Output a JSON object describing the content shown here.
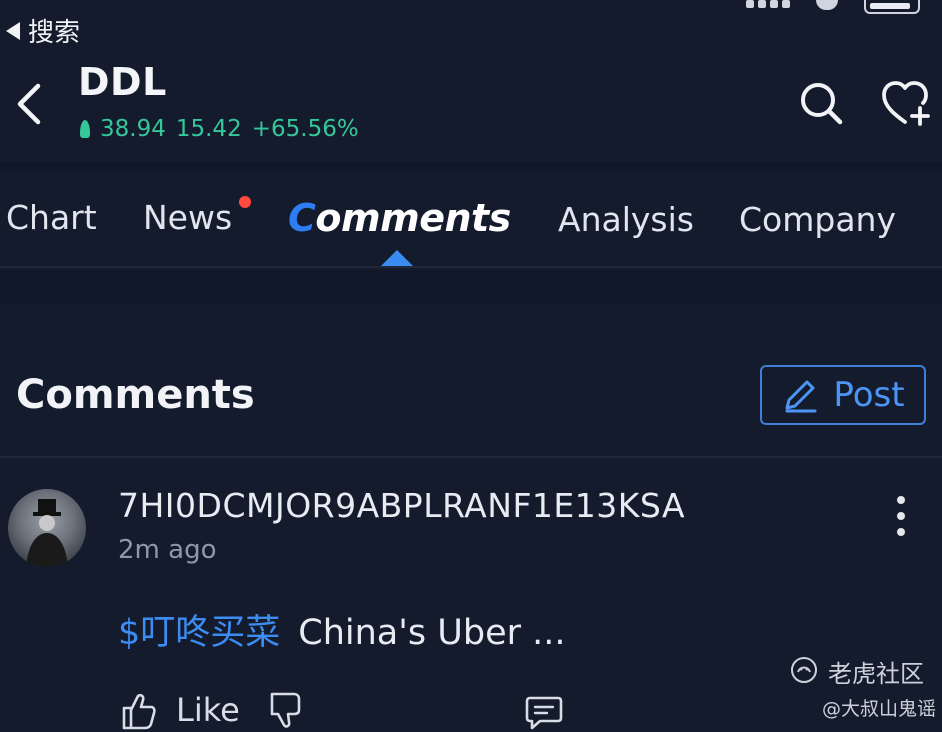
{
  "status_bar": {
    "back_app_label": "搜索"
  },
  "header": {
    "ticker": "DDL",
    "price": "38.94",
    "change": "15.42",
    "change_percent": "+65.56%",
    "up_color": "#35c79a"
  },
  "tabs": [
    {
      "label": "Chart"
    },
    {
      "label": "News",
      "has_notification": true
    },
    {
      "label": "Comments",
      "active": true
    },
    {
      "label": "Analysis"
    },
    {
      "label": "Company"
    }
  ],
  "comments_section": {
    "title": "Comments",
    "post_label": "Post"
  },
  "comment": {
    "username": "7HI0DCMJOR9ABPLRANF1E13KSA",
    "time": "2m ago",
    "stock_tag": "$叮咚买菜",
    "text": "China's Uber ...",
    "like_label": "Like"
  },
  "watermark": {
    "community": "老虎社区",
    "author": "@大叔山鬼谣"
  },
  "colors": {
    "background": "#141b2d",
    "accent": "#3b8cf2",
    "notification": "#ff4a3d"
  },
  "icons": [
    "back-arrow-icon",
    "search-icon",
    "watchlist-add-icon",
    "pencil-icon",
    "more-icon",
    "thumb-up-icon",
    "thumb-down-icon",
    "reply-icon"
  ]
}
